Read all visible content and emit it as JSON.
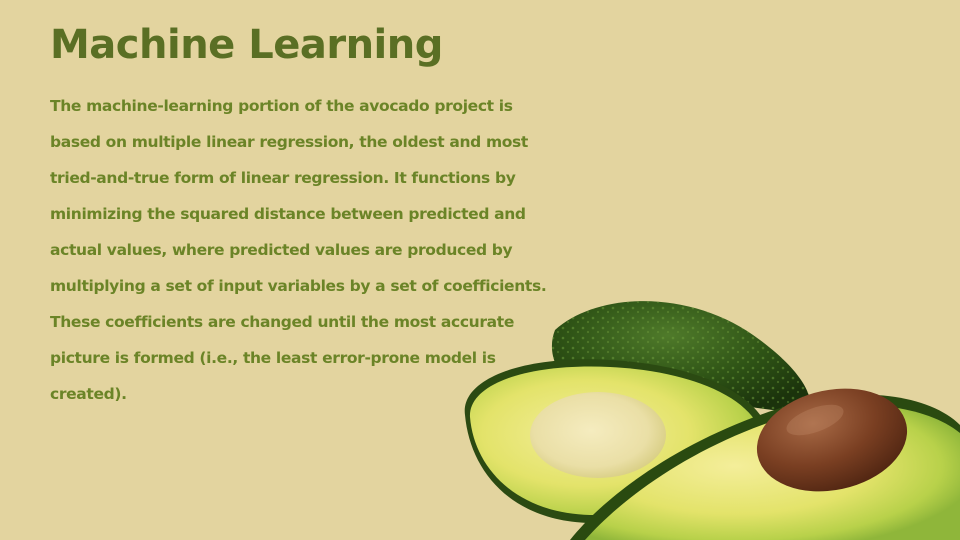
{
  "slide": {
    "title": "Machine Learning",
    "body_lines": [
      "The machine-learning portion of the avocado project is",
      "based on multiple linear regression, the oldest and most",
      "tried-and-true form of linear regression. It functions by",
      "minimizing the squared distance between predicted and",
      "actual values, where predicted values are produced by",
      "multiplying a set of input variables by a set of coefficients.",
      "These coefficients are changed until the most accurate",
      "picture is formed (i.e.,  the least error-prone model is",
      "created)."
    ]
  },
  "colors": {
    "background": "#e3d49f",
    "title": "#5a6f24",
    "body_text": "#6b8427"
  },
  "image": {
    "subject": "avocado-halves"
  }
}
